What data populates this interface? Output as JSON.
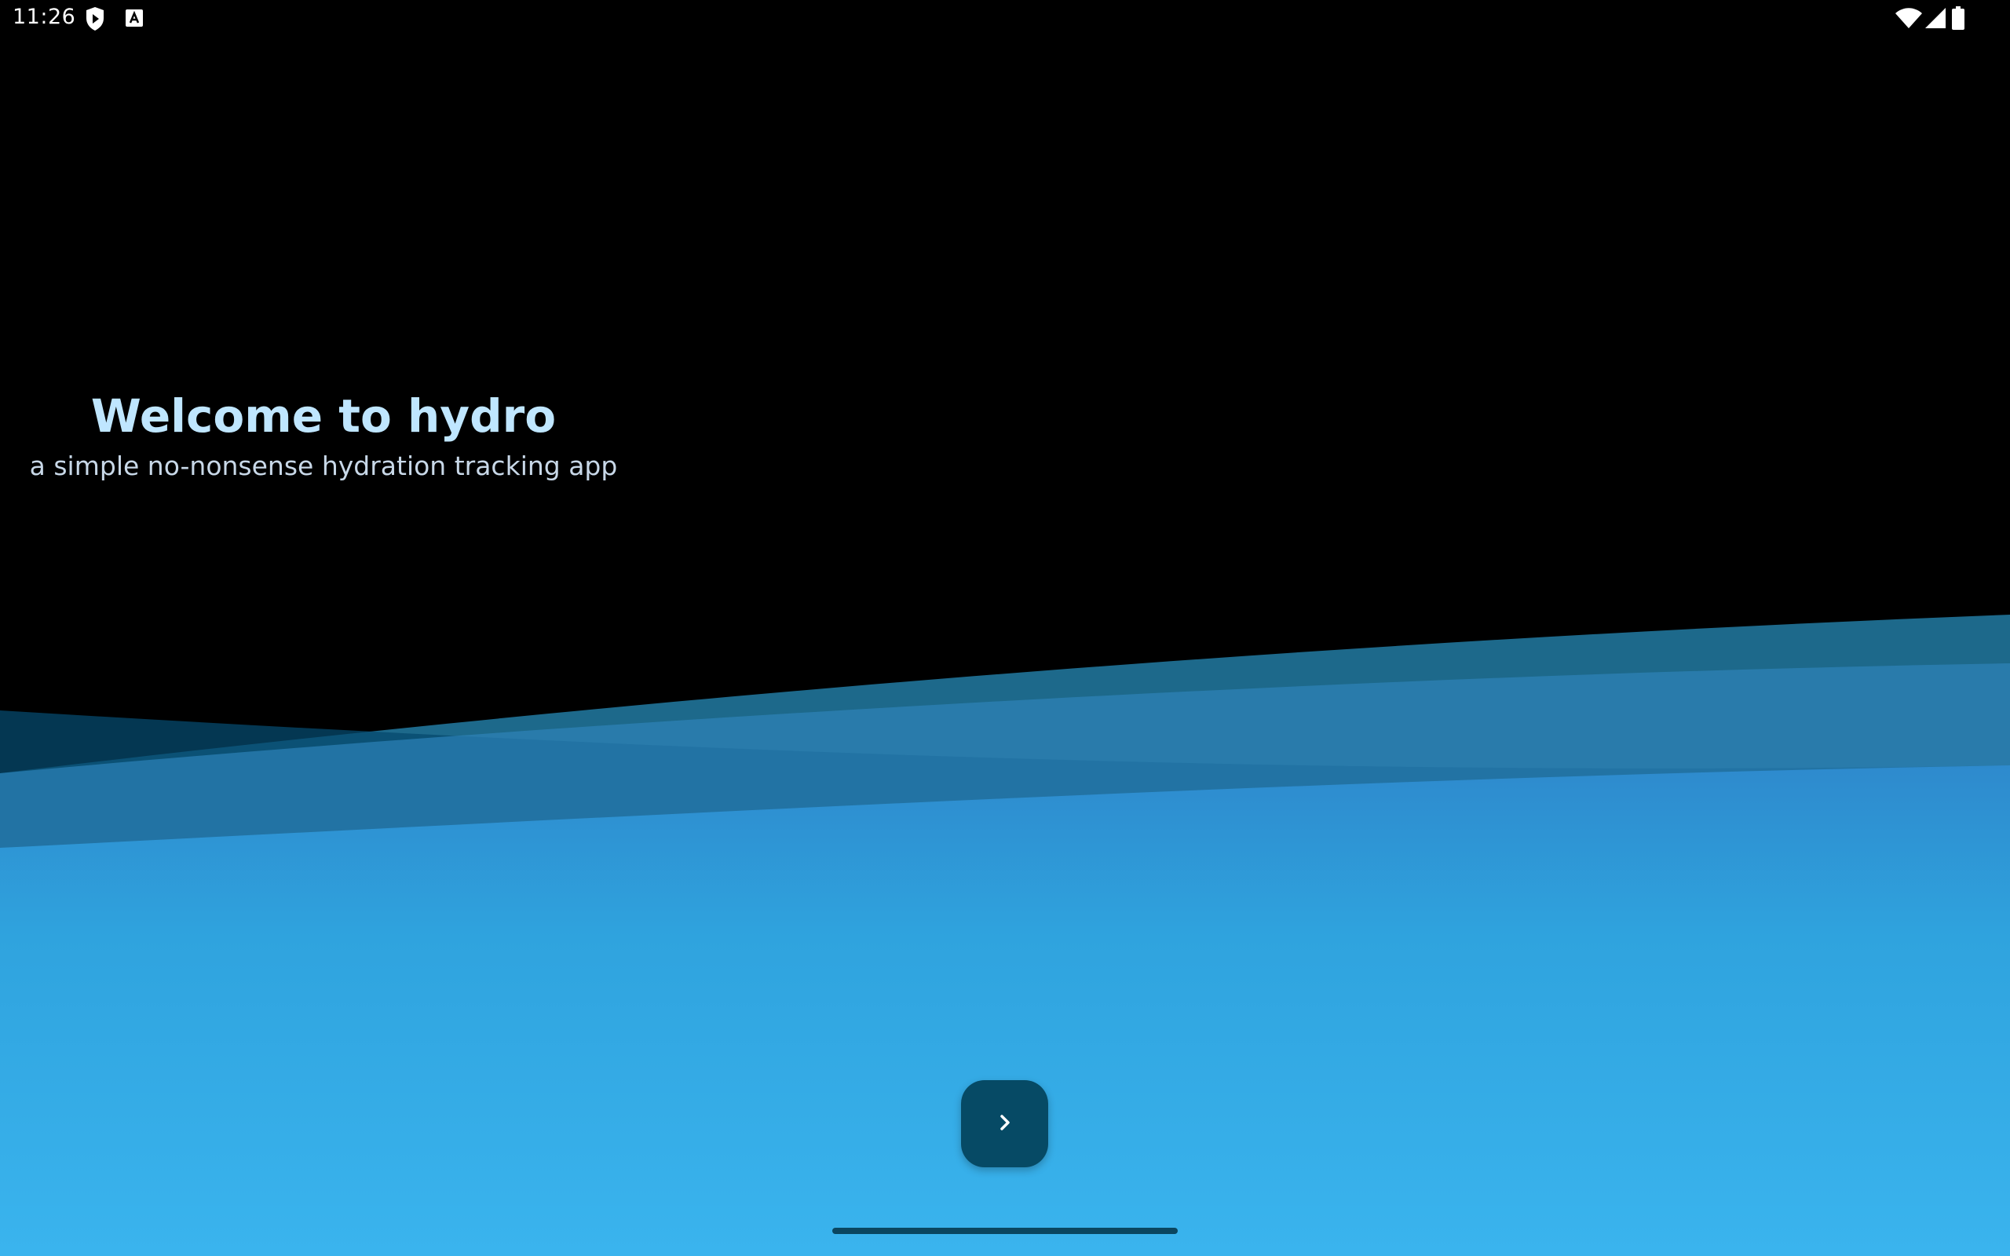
{
  "status_bar": {
    "time": "11:26",
    "left_icons": [
      "shield-play-icon",
      "font-a-icon"
    ],
    "right_icons": [
      "wifi-icon",
      "signal-icon",
      "battery-icon"
    ]
  },
  "welcome": {
    "title": "Welcome to hydro",
    "subtitle": "a simple no-nonsense hydration tracking app"
  },
  "next_button": {
    "icon": "chevron-right-icon"
  },
  "colors": {
    "background": "#000000",
    "title": "#bfe6ff",
    "subtitle": "#c8d8e8",
    "water_light": "#3ab4ee",
    "button": "#064a65"
  }
}
